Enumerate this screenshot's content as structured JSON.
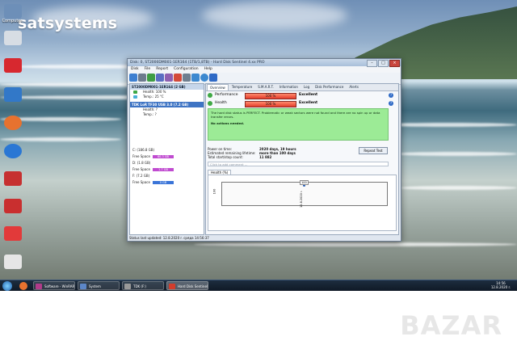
{
  "desktop": {
    "brand": "satsystems",
    "icons": [
      "Computer",
      "",
      "",
      "",
      "",
      "",
      "",
      "",
      "",
      ""
    ]
  },
  "window": {
    "title": "Disk: 0, ST2000DM001-1ER164 (1TB/1,8TB) - Hard Disk Sentinel 4.xx PRO",
    "menu": [
      "Disk",
      "File",
      "Report",
      "Configuration",
      "Help"
    ],
    "disks": [
      {
        "name": "ST2000DM001-1ER164 (2 GB)",
        "health": "100 %",
        "temp": "25 °C"
      },
      {
        "name": "TDK LoR TF30 USB 3.0 (7.2 GB)",
        "health": "?",
        "temp": "?"
      }
    ],
    "partitions": [
      {
        "drive": "C:",
        "size": "(186.8 GB)",
        "free_label": "Free Space",
        "free": "60.3 GB",
        "color": "#c04bd0"
      },
      {
        "drive": "D:",
        "size": "(1.8 GB)",
        "free_label": "Free Space",
        "free": "1.7 GB",
        "color": "#c04bd0"
      },
      {
        "drive": "F:",
        "size": "(7.2 GB)",
        "free_label": "Free Space",
        "free": "0 GB",
        "color": "#3a74d8"
      }
    ],
    "tabs": [
      "Overview",
      "Temperature",
      "S.M.A.R.T.",
      "Information",
      "Log",
      "Disk Performance",
      "Alerts"
    ],
    "performance": {
      "label": "Performance",
      "value": "100 %",
      "status": "Excellent"
    },
    "health": {
      "label": "Health",
      "value": "100 %",
      "status": "Excellent"
    },
    "message": "The hard disk status is PERFECT. Problematic or weak sectors were not found and there are no spin up or data transfer errors.",
    "no_actions": "No actions needed.",
    "power_on_label": "Power on time:",
    "power_on": "2020 days, 19 hours",
    "lifetime_label": "Estimated remaining lifetime:",
    "lifetime": "more than 100 days",
    "startstop_label": "Total start/stop count:",
    "startstop": "11 882",
    "repeat_test": "Repeat Test",
    "comment_placeholder": "Click to add comment ...",
    "health_tab": "Health (%)",
    "chart_y_label": "100",
    "point_label": "100",
    "date_label": "12.8.2020 r.",
    "statusbar": "Status last updated: 12.8.2020 r. сряда 14:56:37"
  },
  "taskbar": {
    "buttons": [
      "Software - WinRAR",
      "System",
      "TDK (F:)",
      "Hard Disk Sentinel"
    ],
    "time": "14:56",
    "date": "12.8.2020 r."
  },
  "watermark": "BAZAR"
}
